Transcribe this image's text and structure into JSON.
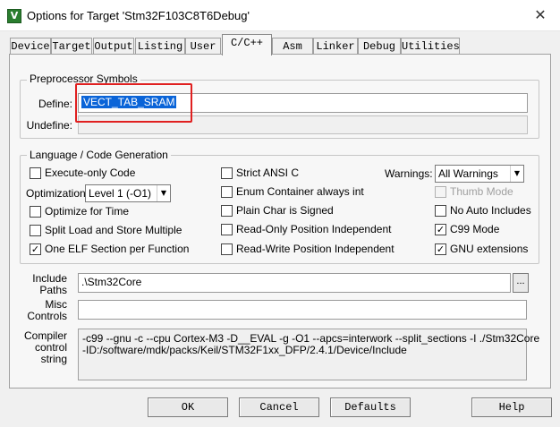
{
  "window": {
    "title": "Options for Target 'Stm32F103C8T6Debug'",
    "icon_letter": "V"
  },
  "tabs": [
    {
      "label": "Device"
    },
    {
      "label": "Target"
    },
    {
      "label": "Output"
    },
    {
      "label": "Listing"
    },
    {
      "label": "User"
    },
    {
      "label": "C/C++"
    },
    {
      "label": "Asm"
    },
    {
      "label": "Linker"
    },
    {
      "label": "Debug"
    },
    {
      "label": "Utilities"
    }
  ],
  "active_tab": "C/C++",
  "preprocessor": {
    "title": "Preprocessor Symbols",
    "define_label": "Define:",
    "define_value": "VECT_TAB_SRAM",
    "undefine_label": "Undefine:",
    "undefine_value": ""
  },
  "language": {
    "title": "Language / Code Generation",
    "execute_only": {
      "label": "Execute-only Code",
      "checked": false
    },
    "optimization_label": "Optimization:",
    "optimization_value": "Level 1 (-O1)",
    "optimize_time": {
      "label": "Optimize for Time",
      "checked": false
    },
    "split_load": {
      "label": "Split Load and Store Multiple",
      "checked": false
    },
    "one_elf": {
      "label": "One ELF Section per Function",
      "checked": true
    },
    "strict_ansi": {
      "label": "Strict ANSI C",
      "checked": false
    },
    "enum_container": {
      "label": "Enum Container always int",
      "checked": false
    },
    "plain_char": {
      "label": "Plain Char is Signed",
      "checked": false
    },
    "ropi": {
      "label": "Read-Only Position Independent",
      "checked": false
    },
    "rwpi": {
      "label": "Read-Write Position Independent",
      "checked": false
    },
    "warnings_label": "Warnings:",
    "warnings_value": "All Warnings",
    "thumb_mode": {
      "label": "Thumb Mode",
      "checked": false,
      "disabled": true
    },
    "no_auto_includes": {
      "label": "No Auto Includes",
      "checked": false
    },
    "c99_mode": {
      "label": "C99 Mode",
      "checked": true
    },
    "gnu_extensions": {
      "label": "GNU extensions",
      "checked": true
    }
  },
  "paths": {
    "include_label_1": "Include",
    "include_label_2": "Paths",
    "include_value": ".\\Stm32Core",
    "browse_label": "...",
    "misc_label_1": "Misc",
    "misc_label_2": "Controls",
    "misc_value": ""
  },
  "compiler": {
    "label_1": "Compiler",
    "label_2": "control",
    "label_3": "string",
    "line_1": "-c99 --gnu -c --cpu Cortex-M3 -D__EVAL -g -O1 --apcs=interwork --split_sections -I ./Stm32Core",
    "line_2": "-ID:/software/mdk/packs/Keil/STM32F1xx_DFP/2.4.1/Device/Include"
  },
  "buttons": {
    "ok": "OK",
    "cancel": "Cancel",
    "defaults": "Defaults",
    "help": "Help"
  },
  "check_glyph": "✓",
  "colors": {
    "selection": "#0a64d8",
    "highlight_box": "#e02020"
  }
}
